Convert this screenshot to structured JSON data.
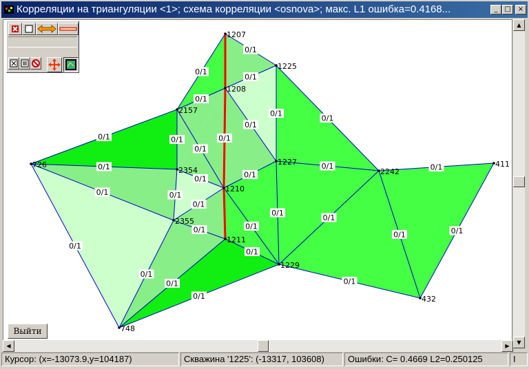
{
  "window": {
    "title": "Корреляции на триангуляции <1>; схема корреляции <osnova>; макс. L1 ошибка=0.4168...",
    "minimize_label": "_",
    "maximize_label": "□",
    "close_label": "×"
  },
  "toolbox": {
    "tools": [
      "delete-red-icon",
      "square-icon",
      "double-arrow-icon",
      "equals-bar-icon",
      "close-box-icon",
      "list-icon",
      "no-entry-icon",
      "move-icon",
      "map-icon"
    ]
  },
  "map": {
    "edge_label": "0/1",
    "wells": [
      {
        "name": "1207"
      },
      {
        "name": "1225"
      },
      {
        "name": "1208"
      },
      {
        "name": "2157"
      },
      {
        "name": "726"
      },
      {
        "name": "2354"
      },
      {
        "name": "1227"
      },
      {
        "name": "2242"
      },
      {
        "name": "411"
      },
      {
        "name": "1210"
      },
      {
        "name": "2355"
      },
      {
        "name": "1211"
      },
      {
        "name": "1229"
      },
      {
        "name": "432"
      },
      {
        "name": "748"
      }
    ],
    "colors": {
      "fill_light": "#ccffcc",
      "fill_mid": "#88ee88",
      "fill_green": "#44ff44",
      "fill_bright": "#11ee11",
      "edge": "#0000cc",
      "highlight": "#ff0000"
    }
  },
  "buttons": {
    "exit_label": "Выйти"
  },
  "status": {
    "cursor": "Курсор: (x=-13073.9,y=104187)",
    "well": "Скважина '1225': (-13317, 103608)",
    "errors": "Ошибки: C=  0.4669 L2=0.250125",
    "extra": "I"
  }
}
